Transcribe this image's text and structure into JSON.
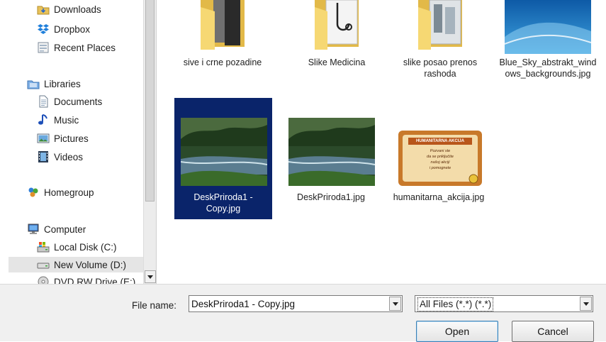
{
  "nav": {
    "items": [
      {
        "label": "Downloads",
        "icon": "downloads-folder-icon"
      },
      {
        "label": "Dropbox",
        "icon": "dropbox-icon"
      },
      {
        "label": "Recent Places",
        "icon": "recent-places-icon"
      },
      {
        "label": "Libraries",
        "icon": "libraries-icon"
      },
      {
        "label": "Documents",
        "icon": "documents-icon"
      },
      {
        "label": "Music",
        "icon": "music-icon"
      },
      {
        "label": "Pictures",
        "icon": "pictures-icon"
      },
      {
        "label": "Videos",
        "icon": "videos-icon"
      },
      {
        "label": "Homegroup",
        "icon": "homegroup-icon"
      },
      {
        "label": "Computer",
        "icon": "computer-icon"
      },
      {
        "label": "Local Disk (C:)",
        "icon": "local-disk-icon"
      },
      {
        "label": "New Volume (D:)",
        "icon": "drive-icon"
      },
      {
        "label": "DVD RW Drive (E:)",
        "icon": "dvd-drive-icon"
      }
    ]
  },
  "files": [
    {
      "name": "sive i crne pozadine",
      "type": "folder"
    },
    {
      "name": "Slike Medicina",
      "type": "folder"
    },
    {
      "name": "slike posao prenos rashoda",
      "type": "folder"
    },
    {
      "name": "Blue_Sky_abstrakt_windows_backgrounds.jpg",
      "type": "image"
    },
    {
      "name": "DeskPriroda1 - Copy.jpg",
      "type": "image",
      "selected": true
    },
    {
      "name": "DeskPriroda1.jpg",
      "type": "image"
    },
    {
      "name": "humanitarna_akcija.jpg",
      "type": "image"
    }
  ],
  "thumb_text": {
    "akcija_title": "HUMANITARNA AKCIJA",
    "akcija_body": [
      "Pozvani ste",
      "da se priključite",
      "našoj akciji",
      "i pomognete"
    ]
  },
  "bottom": {
    "file_name_label": "File name:",
    "file_name_value": "DeskPriroda1 - Copy.jpg",
    "filter_value": "All Files (*.*) (*.*)",
    "open_label": "Open",
    "cancel_label": "Cancel"
  },
  "colors": {
    "selection": "#0a246a",
    "nav_selected": "#e5e5e5",
    "folder": "#f2cd5d"
  }
}
